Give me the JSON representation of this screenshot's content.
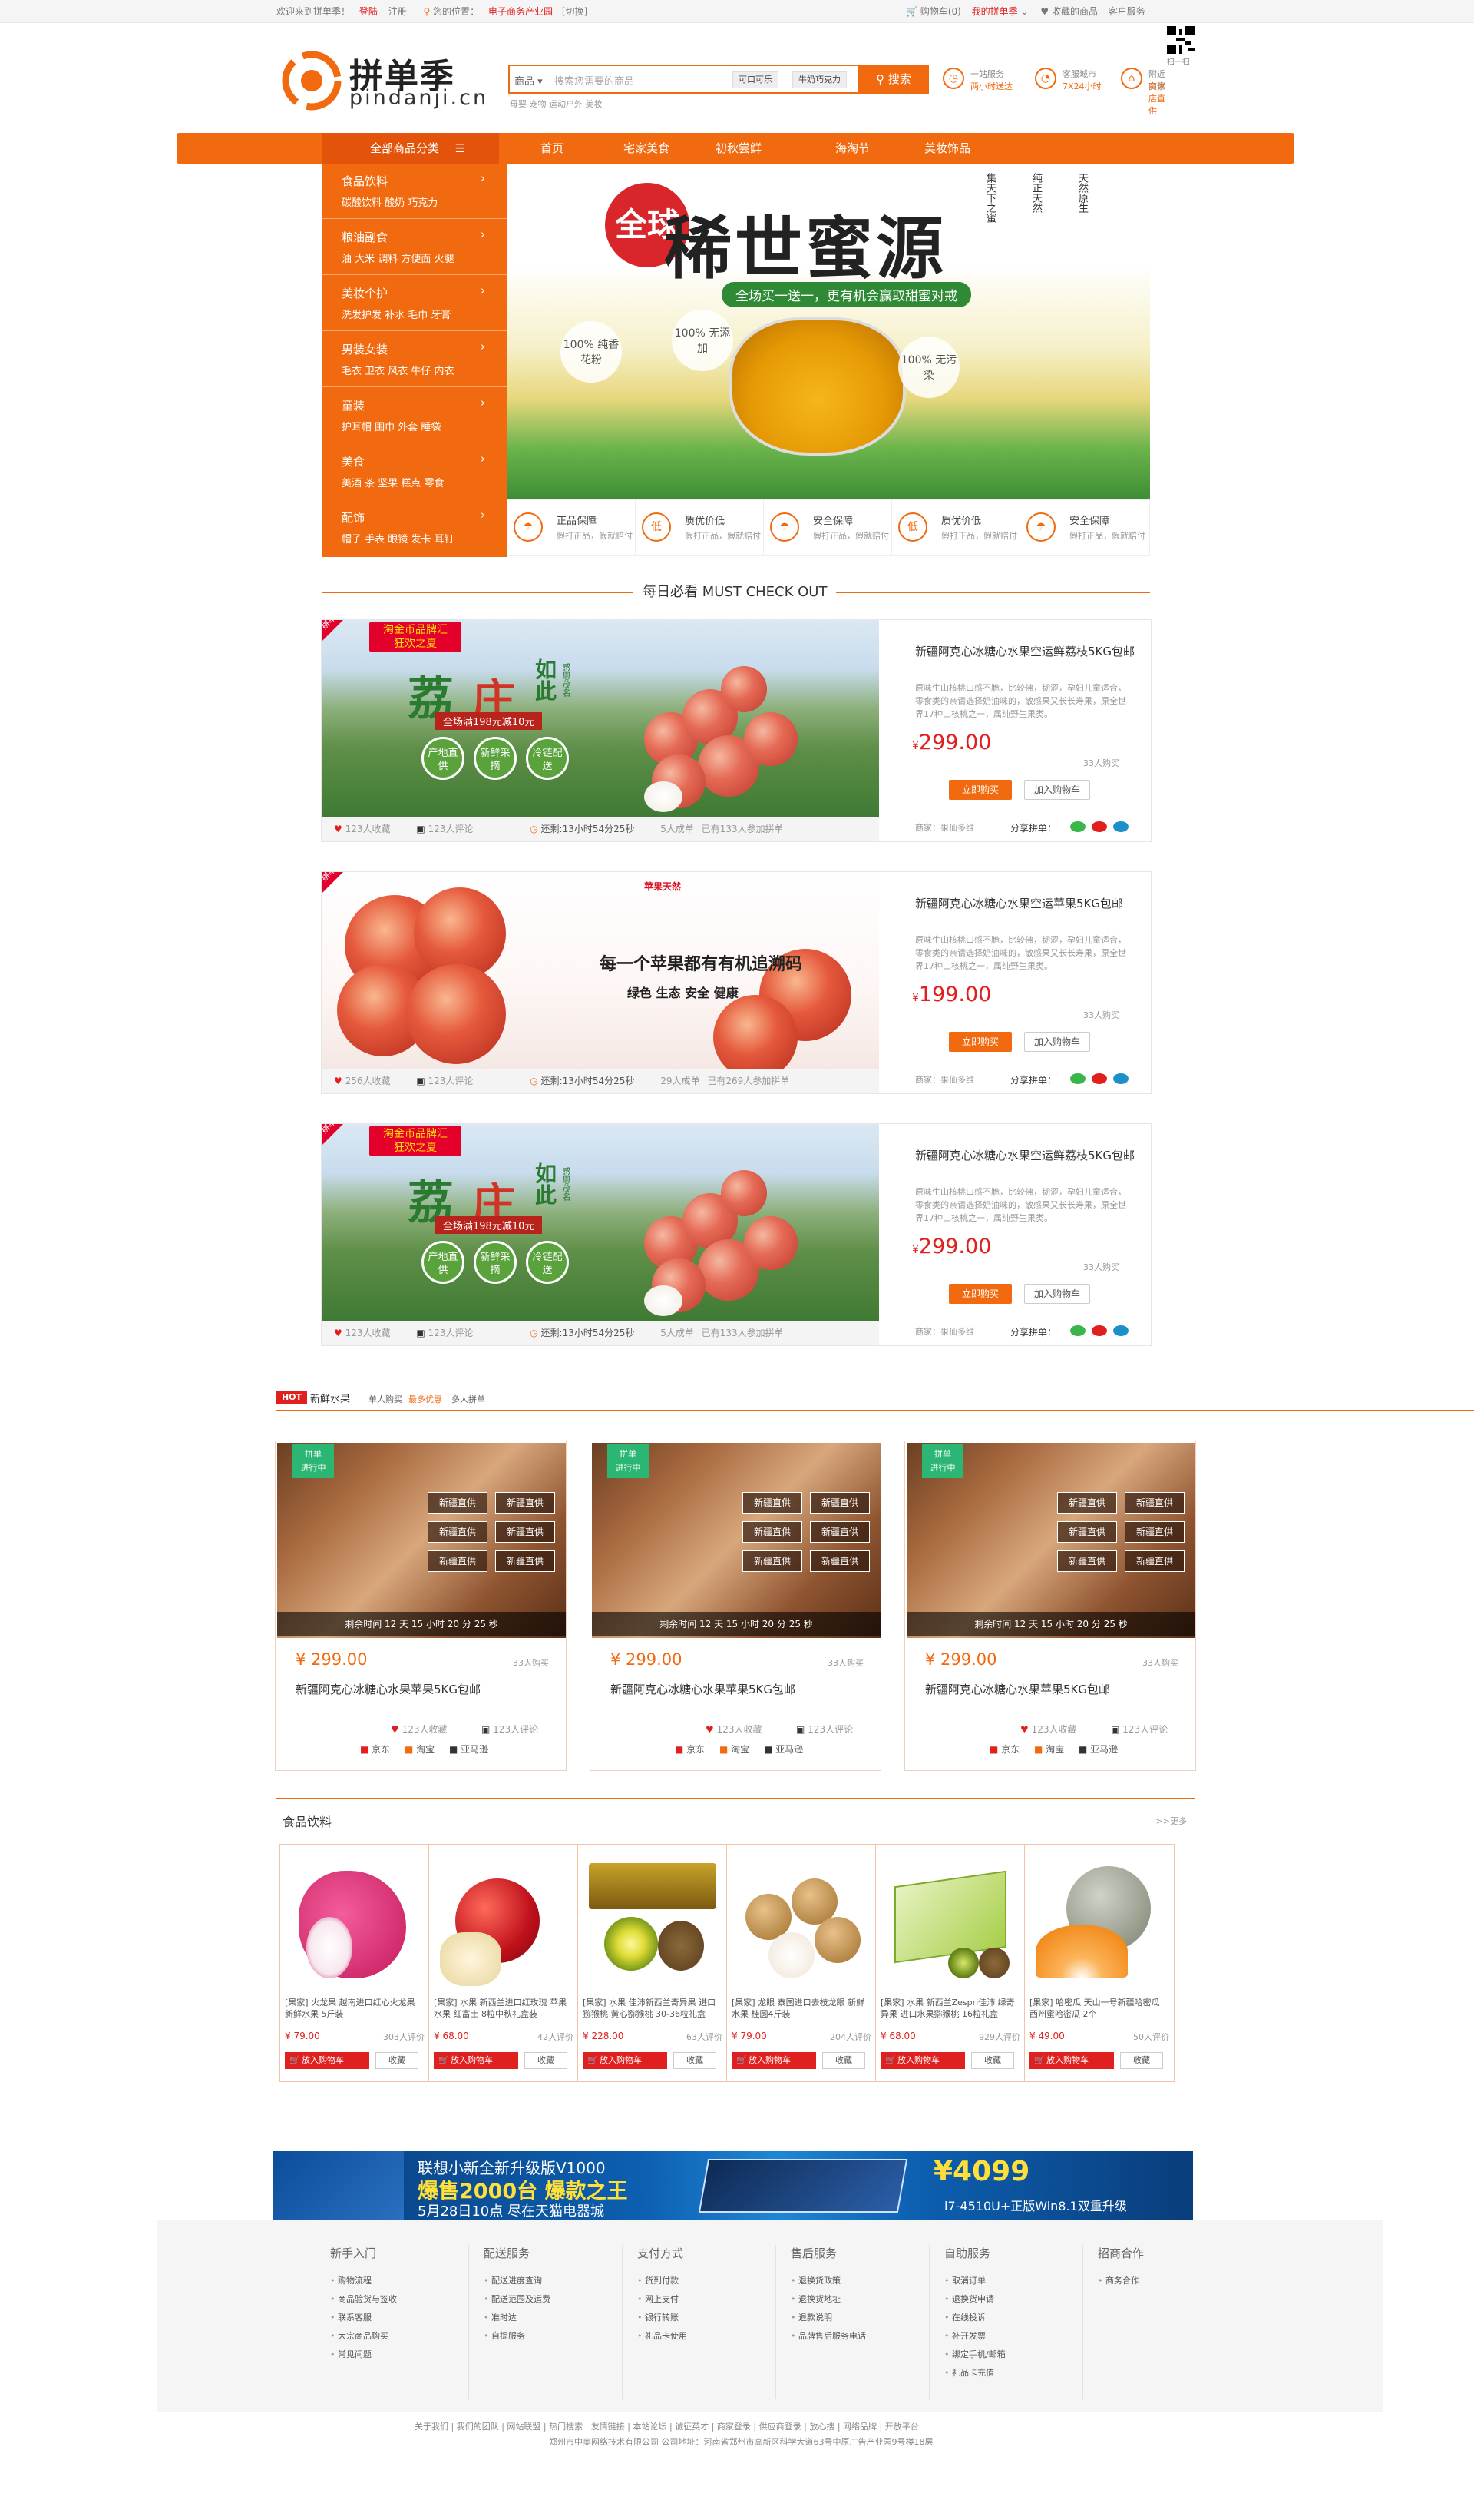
{
  "topbar": {
    "welcome": "欢迎来到拼单季！",
    "login": "登陆",
    "register": "注册",
    "location_label": "您的位置：",
    "location_value": "电子商务产业园",
    "switch": "[切换]",
    "cart": "购物车(0)",
    "my": "我的拼单季",
    "favorites": "收藏的商品",
    "service": "客户服务"
  },
  "header": {
    "logo_cn": "拼单季",
    "logo_en": "pindanji.cn",
    "search_category": "商品",
    "search_placeholder": "搜索您需要的商品",
    "search_tags": [
      "可口可乐",
      "牛奶巧克力"
    ],
    "search_button": "搜索",
    "hot_words": "母婴  宠物  运动户外  美妆",
    "services": [
      {
        "line1": "一站服务",
        "line2": "两小时送达"
      },
      {
        "line1": "客服城市",
        "line2": "7X24小时"
      },
      {
        "line1": "附近商家",
        "line2": "实体店直供"
      }
    ],
    "qr_label": "扫一扫"
  },
  "nav": {
    "all": "全部商品分类",
    "items": [
      "首页",
      "宅家美食",
      "初秋尝鲜",
      "海淘节",
      "美妆饰品"
    ]
  },
  "categories": [
    {
      "title": "食品饮料",
      "sub": "碳酸饮料  酸奶  巧克力"
    },
    {
      "title": "粮油副食",
      "sub": "油  大米  调料  方便面  火腿"
    },
    {
      "title": "美妆个护",
      "sub": "洗发护发  补水  毛巾  牙膏"
    },
    {
      "title": "男装女装",
      "sub": "毛衣  卫衣  风衣  牛仔  内衣"
    },
    {
      "title": "童装",
      "sub": "护耳帽  围巾  外套  睡袋"
    },
    {
      "title": "美食",
      "sub": "美酒  茶  坚果  糕点  零食"
    },
    {
      "title": "配饰",
      "sub": "帽子  手表  眼镜  发卡  耳钉"
    }
  ],
  "banner": {
    "badge": "全球",
    "headline": "稀世蜜源",
    "promo": "全场买一送一，更有机会赢取甜蜜对戒",
    "tags": [
      "100% 无添加",
      "100% 纯香花粉",
      "100% 无污染"
    ],
    "vertical": [
      "集天下之蜜",
      "纯正天然",
      "天然原生"
    ]
  },
  "guarantees": [
    {
      "icon": "umbrella-icon",
      "symbol": "☂",
      "title": "正品保障",
      "sub": "假打正品，假就赔付"
    },
    {
      "icon": "low-price-icon",
      "symbol": "低",
      "title": "质优价低",
      "sub": "假打正品，假就赔付"
    },
    {
      "icon": "umbrella-icon",
      "symbol": "☂",
      "title": "安全保障",
      "sub": "假打正品，假就赔付"
    },
    {
      "icon": "low-price-icon",
      "symbol": "低",
      "title": "质优价低",
      "sub": "假打正品，假就赔付"
    },
    {
      "icon": "umbrella-icon",
      "symbol": "☂",
      "title": "安全保障",
      "sub": "假打正品，假就赔付"
    }
  ],
  "daily": {
    "title": "每日必看  MUST CHECK OUT"
  },
  "deals": [
    {
      "ribbon": "拼单购买",
      "pic_brand": "淘金币品牌汇",
      "pic_event": "狂欢之夏",
      "pic_title_1": "荔",
      "pic_title_2": "庄",
      "pic_title_3": "如此",
      "pic_side": "感恩茂名",
      "pic_promo": "全场满198元减10元",
      "pic_badges": [
        "产地直供",
        "新鲜采摘",
        "冷链配送"
      ],
      "favorites": "123人收藏",
      "comments": "123人评论",
      "countdown": "还剩:13小时54分25秒",
      "joined": "5人成单",
      "joined_extra": "已有133人参加拼单",
      "name": "新疆阿克心冰糖心水果空运鲜荔枝5KG包邮",
      "desc": "原味生山核桃口感不脆，比较佛，韧涩，孕妇儿童适合，零食类的亲请选择奶油味的，敏感果又长长寿果，原全世界17种山核桃之一，属纯野生果类。",
      "price": "299.00",
      "sold": "33人购买",
      "buy_now": "立即购买",
      "add_cart": "加入购物车",
      "shop": "商家：果仙多维",
      "share": "分享拼单："
    },
    {
      "ribbon": "拼单购买",
      "pic_title": "每一个苹果都有有机追溯码",
      "pic_sub": "绿色  生态  安全  健康",
      "pic_logo": "苹果天然",
      "favorites": "256人收藏",
      "comments": "123人评论",
      "countdown": "还剩:13小时54分25秒",
      "joined": "29人成单",
      "joined_extra": "已有269人参加拼单",
      "name": "新疆阿克心冰糖心水果空运苹果5KG包邮",
      "desc": "原味生山核桃口感不脆，比较佛，韧涩，孕妇儿童适合，零食类的亲请选择奶油味的，敏感果又长长寿果，原全世界17种山核桃之一，属纯野生果类。",
      "price": "199.00",
      "sold": "33人购买",
      "buy_now": "立即购买",
      "add_cart": "加入购物车",
      "shop": "商家：果仙多维",
      "share": "分享拼单："
    },
    {
      "ribbon": "拼单购买",
      "pic_brand": "淘金币品牌汇",
      "pic_event": "狂欢之夏",
      "pic_title_1": "荔",
      "pic_title_2": "庄",
      "pic_title_3": "如此",
      "pic_side": "感恩茂名",
      "pic_promo": "全场满198元减10元",
      "pic_badges": [
        "产地直供",
        "新鲜采摘",
        "冷链配送"
      ],
      "favorites": "123人收藏",
      "comments": "123人评论",
      "countdown": "还剩:13小时54分25秒",
      "joined": "5人成单",
      "joined_extra": "已有133人参加拼单",
      "name": "新疆阿克心冰糖心水果空运鲜荔枝5KG包邮",
      "desc": "原味生山核桃口感不脆，比较佛，韧涩，孕妇儿童适合，零食类的亲请选择奶油味的，敏感果又长长寿果，原全世界17种山核桃之一，属纯野生果类。",
      "price": "299.00",
      "sold": "33人购买",
      "buy_now": "立即购买",
      "add_cart": "加入购物车",
      "shop": "商家：果仙多维",
      "share": "分享拼单："
    }
  ],
  "hot": {
    "badge": "HOT",
    "title": "新鲜水果",
    "tabs": [
      "单人购买",
      "最多优惠",
      "多人拼单"
    ],
    "items": [
      {
        "tag1": "拼单",
        "tag2": "进行中",
        "label": "新疆直供",
        "countdown": "剩余时间 12 天 15 小时 20 分 25 秒",
        "price": "¥ 299.00",
        "sold": "33人购买",
        "name": "新疆阿克心冰糖心水果苹果5KG包邮",
        "fav": "123人收藏",
        "cmt": "123人评论",
        "platforms": [
          "京东",
          "淘宝",
          "亚马逊"
        ]
      },
      {
        "tag1": "拼单",
        "tag2": "进行中",
        "label": "新疆直供",
        "countdown": "剩余时间 12 天 15 小时 20 分 25 秒",
        "price": "¥ 299.00",
        "sold": "33人购买",
        "name": "新疆阿克心冰糖心水果苹果5KG包邮",
        "fav": "123人收藏",
        "cmt": "123人评论",
        "platforms": [
          "京东",
          "淘宝",
          "亚马逊"
        ]
      },
      {
        "tag1": "拼单",
        "tag2": "进行中",
        "label": "新疆直供",
        "countdown": "剩余时间 12 天 15 小时 20 分 25 秒",
        "price": "¥ 299.00",
        "sold": "33人购买",
        "name": "新疆阿克心冰糖心水果苹果5KG包邮",
        "fav": "123人收藏",
        "cmt": "123人评论",
        "platforms": [
          "京东",
          "淘宝",
          "亚马逊"
        ]
      }
    ]
  },
  "food": {
    "title": "食品饮料",
    "more": ">>更多",
    "items": [
      {
        "name": "[果家] 火龙果 越南进口红心火龙果 新鲜水果 5斤装",
        "price": "¥ 79.00",
        "evals": "303人评价",
        "kind": "dragonfruit"
      },
      {
        "name": "[果家] 水果 新西兰进口红玫瑰 苹果水果 红富士 8粒中秋礼盒装",
        "price": "¥ 68.00",
        "evals": "42人评价",
        "kind": "apple"
      },
      {
        "name": "[果家] 水果 佳沛新西兰奇异果 进口猕猴桃 黄心猕猴桃 30-36粒礼盒",
        "price": "¥ 228.00",
        "evals": "63人评价",
        "kind": "kiwi"
      },
      {
        "name": "[果家] 龙眼 泰国进口去枝龙眼 新鲜水果 桂圆4斤装",
        "price": "¥ 79.00",
        "evals": "204人评价",
        "kind": "longan"
      },
      {
        "name": "[果家] 水果 新西兰Zespri佳沛 绿奇异果 进口水果猕猴桃 16粒礼盒",
        "price": "¥ 68.00",
        "evals": "929人评价",
        "kind": "kiwibox"
      },
      {
        "name": "[果家] 哈密瓜 天山一号新疆哈密瓜 西州蜜哈密瓜 2个",
        "price": "¥ 49.00",
        "evals": "50人评价",
        "kind": "melon"
      }
    ],
    "add_cart": "放入购物车",
    "favorite": "收藏"
  },
  "ad": {
    "line1": "联想小新全新升级版V1000",
    "line2": "爆售2000台  爆款之王",
    "line3": "5月28日10点 尽在天猫电器城",
    "price": "¥4099",
    "spec": "i7-4510U+正版Win8.1双重升级"
  },
  "footer": {
    "columns": [
      {
        "title": "新手入门",
        "items": [
          "购物流程",
          "商品验货与签收",
          "联系客服",
          "大宗商品购买",
          "常见问题"
        ]
      },
      {
        "title": "配送服务",
        "items": [
          "配送进度查询",
          "配送范围及运费",
          "准时达",
          "自提服务"
        ]
      },
      {
        "title": "支付方式",
        "items": [
          "货到付款",
          "网上支付",
          "银行转账",
          "礼品卡使用"
        ]
      },
      {
        "title": "售后服务",
        "items": [
          "退换货政策",
          "退换货地址",
          "退款说明",
          "品牌售后服务电话"
        ]
      },
      {
        "title": "自助服务",
        "items": [
          "取消订单",
          "退换货申请",
          "在线投诉",
          "补开发票",
          "绑定手机/邮箱",
          "礼品卡充值"
        ]
      },
      {
        "title": "招商合作",
        "items": [
          "商务合作"
        ]
      }
    ],
    "links": [
      "关于我们",
      "我们的团队",
      "网站联盟",
      "热门搜索",
      "友情链接",
      "本站论坛",
      "诚征英才",
      "商家登录",
      "供应商登录",
      "放心搜",
      "网络品牌",
      "开放平台"
    ],
    "copyright": "郑州市中奥网络技术有限公司    公司地址：河南省郑州市高新区科学大道63号中原广告产业园9号楼18层"
  }
}
